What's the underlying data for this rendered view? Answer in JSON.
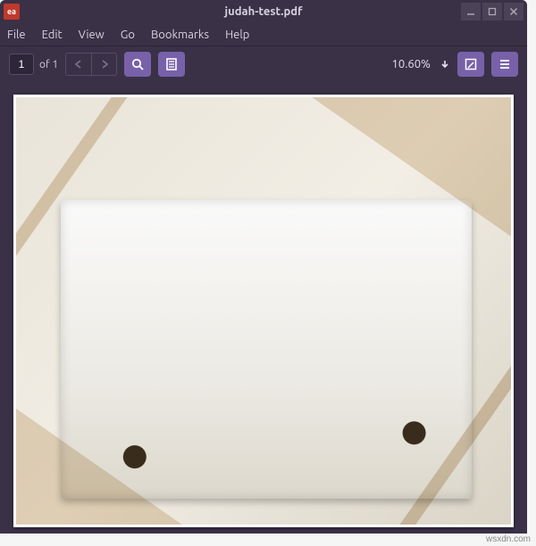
{
  "title": "judah-test.pdf",
  "app_icon_text": "ea",
  "menu": {
    "file": "File",
    "edit": "Edit",
    "view": "View",
    "go": "Go",
    "bookmarks": "Bookmarks",
    "help": "Help"
  },
  "toolbar": {
    "page_current": "1",
    "page_of": "of 1",
    "zoom": "10.60%"
  },
  "watermark": "wsxdn.com"
}
